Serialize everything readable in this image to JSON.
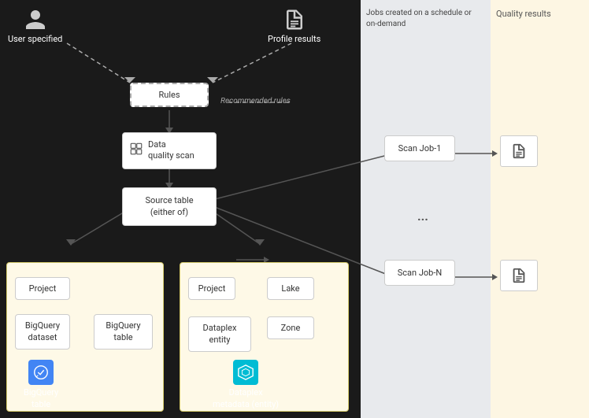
{
  "sections": {
    "left_bg": "#1a1a1a",
    "middle_bg": "#e8eaed",
    "right_bg": "#fdf6e3"
  },
  "labels": {
    "user_specified": "User specified",
    "profile_results": "Profile results",
    "jobs_header": "Jobs created on a schedule or on-demand",
    "quality_results": "Quality results",
    "rules": "Rules",
    "recommended_rules": "Recommended rules",
    "data_quality_scan": "Data quality scan",
    "source_table": "Source table\n(either of)",
    "source_table_line1": "Source table",
    "source_table_line2": "(either of)",
    "scan_job_1": "Scan Job-1",
    "scan_job_n": "Scan Job-N",
    "ellipsis": "...",
    "project_bq": "Project",
    "bigquery_dataset": "BigQuery\ndataset",
    "bigquery_table_inner": "BigQuery\ntable",
    "project_dp": "Project",
    "lake": "Lake",
    "zone": "Zone",
    "dataplex_entity": "Dataplex\nentity",
    "bigquery_table_bottom": "BigQuery\ntable",
    "dataplex_metadata": "Dataplex\nmetadata (entity)"
  }
}
